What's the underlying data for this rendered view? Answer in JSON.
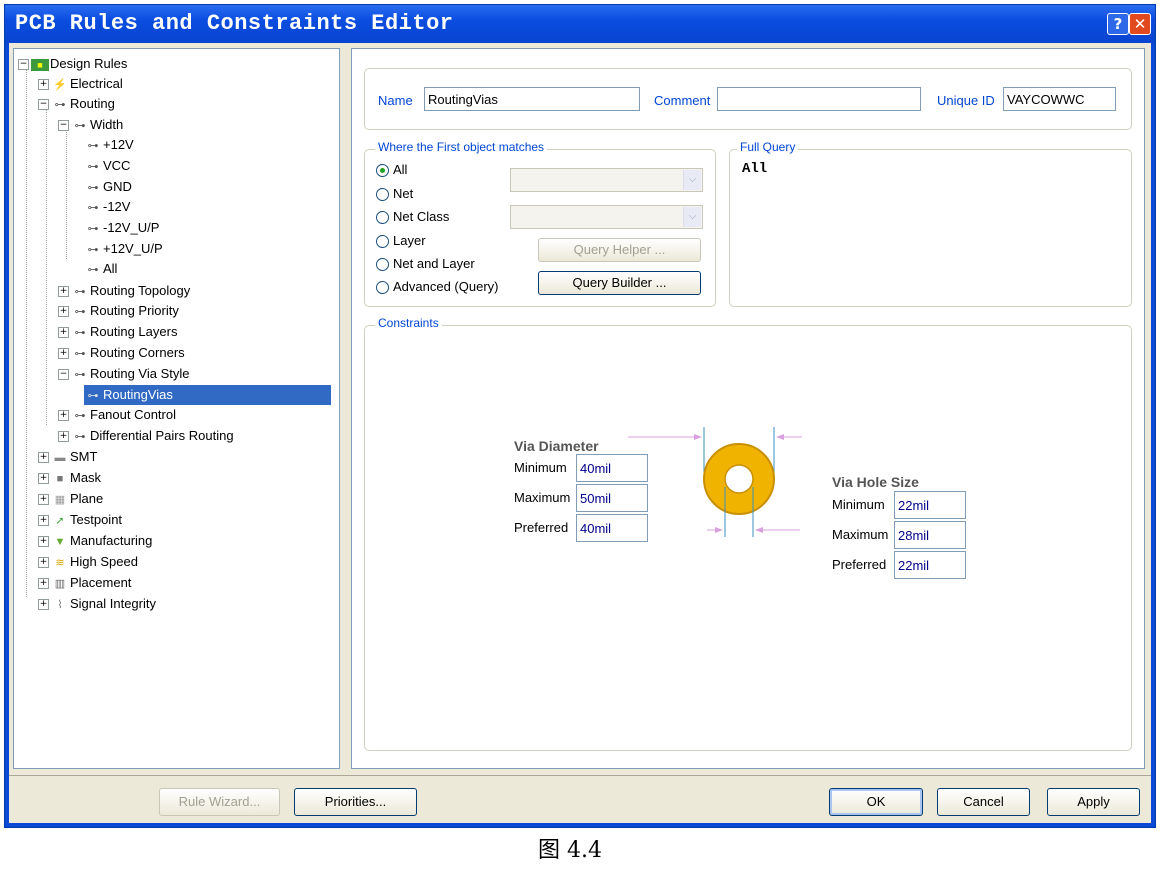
{
  "window": {
    "title": "PCB Rules and Constraints Editor",
    "help_glyph": "?",
    "close_glyph": "✕"
  },
  "tree": {
    "items": [
      "Design Rules",
      "Electrical",
      "Routing",
      "Width",
      "+12V",
      "VCC",
      "GND",
      "-12V",
      "-12V_U/P",
      "+12V_U/P",
      "All",
      "Routing Topology",
      "Routing Priority",
      "Routing Layers",
      "Routing Corners",
      "Routing Via Style",
      "RoutingVias",
      "Fanout Control",
      "Differential Pairs Routing",
      "SMT",
      "Mask",
      "Plane",
      "Testpoint",
      "Manufacturing",
      "High Speed",
      "Placement",
      "Signal Integrity"
    ]
  },
  "header": {
    "name_label": "Name",
    "name_value": "RoutingVias",
    "comment_label": "Comment",
    "comment_value": "",
    "uid_label": "Unique ID",
    "uid_value": "VAYCOWWC"
  },
  "where": {
    "legend": "Where the First object matches",
    "options": [
      "All",
      "Net",
      "Net Class",
      "Layer",
      "Net and Layer",
      "Advanced (Query)"
    ],
    "selected": "All",
    "query_helper": "Query Helper ...",
    "query_builder": "Query Builder ..."
  },
  "full_query": {
    "legend": "Full Query",
    "text": "All"
  },
  "constraints": {
    "legend": "Constraints",
    "via_diameter": {
      "title": "Via Diameter",
      "minimum_label": "Minimum",
      "minimum": "40mil",
      "maximum_label": "Maximum",
      "maximum": "50mil",
      "preferred_label": "Preferred",
      "preferred": "40mil"
    },
    "via_hole": {
      "title": "Via Hole Size",
      "minimum_label": "Minimum",
      "minimum": "22mil",
      "maximum_label": "Maximum",
      "maximum": "28mil",
      "preferred_label": "Preferred",
      "preferred": "22mil"
    },
    "via_color": "#f0b400"
  },
  "footer": {
    "rule_wizard": "Rule Wizard...",
    "priorities": "Priorities...",
    "ok": "OK",
    "cancel": "Cancel",
    "apply": "Apply"
  },
  "caption": "图 4.4"
}
